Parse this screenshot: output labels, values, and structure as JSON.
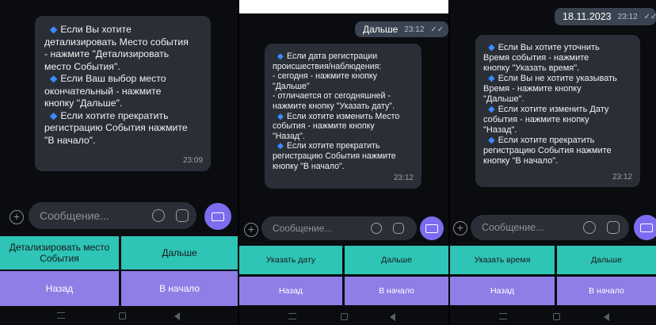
{
  "panel1": {
    "bubble_lines": [
      {
        "bullet": true,
        "text": "Если Вы хотите"
      },
      {
        "bullet": false,
        "text": "детализировать Место события"
      },
      {
        "bullet": false,
        "text": "- нажмите \"Детализировать"
      },
      {
        "bullet": false,
        "text": "место События\"."
      },
      {
        "bullet": true,
        "text": "Если Ваш выбор место"
      },
      {
        "bullet": false,
        "text": "окончательный - нажмите"
      },
      {
        "bullet": false,
        "text": "кнопку \"Дальше\"."
      },
      {
        "bullet": true,
        "text": "Если хотите прекратить"
      },
      {
        "bullet": false,
        "text": "регистрацию События нажмите"
      },
      {
        "bullet": false,
        "text": "\"В начало\"."
      }
    ],
    "bubble_time": "23:09",
    "input_placeholder": "Сообщение...",
    "buttons": {
      "detail": "Детализировать место События",
      "next": "Дальше",
      "back": "Назад",
      "start": "В начало"
    }
  },
  "panel2": {
    "sent_text": "Дальше",
    "sent_time": "23:12",
    "bubble_lines": [
      {
        "bullet": true,
        "text": "Если дата регистрации"
      },
      {
        "bullet": false,
        "text": "происшествия/наблюдения:"
      },
      {
        "bullet": false,
        "text": "- сегодня - нажмите кнопку"
      },
      {
        "bullet": false,
        "text": "\"Дальше\""
      },
      {
        "bullet": false,
        "text": "- отличается от сегодняшней -"
      },
      {
        "bullet": false,
        "text": "нажмите кнопку \"Указать дату\"."
      },
      {
        "bullet": true,
        "text": "Если хотите изменить Место"
      },
      {
        "bullet": false,
        "text": "события - нажмите кнопку"
      },
      {
        "bullet": false,
        "text": "\"Назад\"."
      },
      {
        "bullet": true,
        "text": "Если хотите прекратить"
      },
      {
        "bullet": false,
        "text": "регистрацию События нажмите"
      },
      {
        "bullet": false,
        "text": "кнопку \"В начало\"."
      }
    ],
    "bubble_time": "23:12",
    "input_placeholder": "Сообщение...",
    "buttons": {
      "date": "Указать дату",
      "next": "Дальше",
      "back": "Назад",
      "start": "В начало"
    }
  },
  "panel3": {
    "sent_text": "18.11.2023",
    "sent_time": "23:12",
    "bubble_lines": [
      {
        "bullet": true,
        "text": "Если Вы хотите уточнить"
      },
      {
        "bullet": false,
        "text": "Время события - нажмите"
      },
      {
        "bullet": false,
        "text": "кнопку \"Указать время\"."
      },
      {
        "bullet": true,
        "text": "Если Вы не хотите указывать"
      },
      {
        "bullet": false,
        "text": "Время - нажмите кнопку"
      },
      {
        "bullet": false,
        "text": "\"Дальше\"."
      },
      {
        "bullet": true,
        "text": "Если хотите изменить Дату"
      },
      {
        "bullet": false,
        "text": "события - нажмите кнопку"
      },
      {
        "bullet": false,
        "text": "\"Назад\"."
      },
      {
        "bullet": true,
        "text": "Если хотите прекратить"
      },
      {
        "bullet": false,
        "text": "регистрацию События нажмите"
      },
      {
        "bullet": false,
        "text": "кнопку \"В начало\"."
      }
    ],
    "bubble_time": "23:12",
    "input_placeholder": "Сообщение...",
    "buttons": {
      "time": "Указать время",
      "next": "Дальше",
      "back": "Назад",
      "start": "В начало"
    }
  },
  "colors": {
    "bubble": "#2a2e36",
    "bullet": "#3b8bff",
    "teal_button": "#2ec4b6",
    "purple_button": "#8e7ee6",
    "keyboard_button": "#7b6cf0"
  },
  "icons": {
    "attach": "plus-circle-icon",
    "emoji": "emoji-icon",
    "sticker": "sticker-icon",
    "keyboard": "keyboard-icon",
    "read": "double-check-icon",
    "bullet": "diamond-icon"
  }
}
